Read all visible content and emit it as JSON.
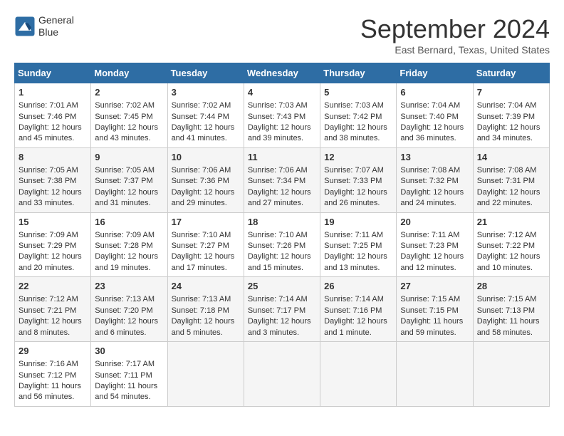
{
  "header": {
    "logo_line1": "General",
    "logo_line2": "Blue",
    "month": "September 2024",
    "location": "East Bernard, Texas, United States"
  },
  "weekdays": [
    "Sunday",
    "Monday",
    "Tuesday",
    "Wednesday",
    "Thursday",
    "Friday",
    "Saturday"
  ],
  "weeks": [
    [
      {
        "day": "1",
        "info": "Sunrise: 7:01 AM\nSunset: 7:46 PM\nDaylight: 12 hours\nand 45 minutes."
      },
      {
        "day": "2",
        "info": "Sunrise: 7:02 AM\nSunset: 7:45 PM\nDaylight: 12 hours\nand 43 minutes."
      },
      {
        "day": "3",
        "info": "Sunrise: 7:02 AM\nSunset: 7:44 PM\nDaylight: 12 hours\nand 41 minutes."
      },
      {
        "day": "4",
        "info": "Sunrise: 7:03 AM\nSunset: 7:43 PM\nDaylight: 12 hours\nand 39 minutes."
      },
      {
        "day": "5",
        "info": "Sunrise: 7:03 AM\nSunset: 7:42 PM\nDaylight: 12 hours\nand 38 minutes."
      },
      {
        "day": "6",
        "info": "Sunrise: 7:04 AM\nSunset: 7:40 PM\nDaylight: 12 hours\nand 36 minutes."
      },
      {
        "day": "7",
        "info": "Sunrise: 7:04 AM\nSunset: 7:39 PM\nDaylight: 12 hours\nand 34 minutes."
      }
    ],
    [
      {
        "day": "8",
        "info": "Sunrise: 7:05 AM\nSunset: 7:38 PM\nDaylight: 12 hours\nand 33 minutes."
      },
      {
        "day": "9",
        "info": "Sunrise: 7:05 AM\nSunset: 7:37 PM\nDaylight: 12 hours\nand 31 minutes."
      },
      {
        "day": "10",
        "info": "Sunrise: 7:06 AM\nSunset: 7:36 PM\nDaylight: 12 hours\nand 29 minutes."
      },
      {
        "day": "11",
        "info": "Sunrise: 7:06 AM\nSunset: 7:34 PM\nDaylight: 12 hours\nand 27 minutes."
      },
      {
        "day": "12",
        "info": "Sunrise: 7:07 AM\nSunset: 7:33 PM\nDaylight: 12 hours\nand 26 minutes."
      },
      {
        "day": "13",
        "info": "Sunrise: 7:08 AM\nSunset: 7:32 PM\nDaylight: 12 hours\nand 24 minutes."
      },
      {
        "day": "14",
        "info": "Sunrise: 7:08 AM\nSunset: 7:31 PM\nDaylight: 12 hours\nand 22 minutes."
      }
    ],
    [
      {
        "day": "15",
        "info": "Sunrise: 7:09 AM\nSunset: 7:29 PM\nDaylight: 12 hours\nand 20 minutes."
      },
      {
        "day": "16",
        "info": "Sunrise: 7:09 AM\nSunset: 7:28 PM\nDaylight: 12 hours\nand 19 minutes."
      },
      {
        "day": "17",
        "info": "Sunrise: 7:10 AM\nSunset: 7:27 PM\nDaylight: 12 hours\nand 17 minutes."
      },
      {
        "day": "18",
        "info": "Sunrise: 7:10 AM\nSunset: 7:26 PM\nDaylight: 12 hours\nand 15 minutes."
      },
      {
        "day": "19",
        "info": "Sunrise: 7:11 AM\nSunset: 7:25 PM\nDaylight: 12 hours\nand 13 minutes."
      },
      {
        "day": "20",
        "info": "Sunrise: 7:11 AM\nSunset: 7:23 PM\nDaylight: 12 hours\nand 12 minutes."
      },
      {
        "day": "21",
        "info": "Sunrise: 7:12 AM\nSunset: 7:22 PM\nDaylight: 12 hours\nand 10 minutes."
      }
    ],
    [
      {
        "day": "22",
        "info": "Sunrise: 7:12 AM\nSunset: 7:21 PM\nDaylight: 12 hours\nand 8 minutes."
      },
      {
        "day": "23",
        "info": "Sunrise: 7:13 AM\nSunset: 7:20 PM\nDaylight: 12 hours\nand 6 minutes."
      },
      {
        "day": "24",
        "info": "Sunrise: 7:13 AM\nSunset: 7:18 PM\nDaylight: 12 hours\nand 5 minutes."
      },
      {
        "day": "25",
        "info": "Sunrise: 7:14 AM\nSunset: 7:17 PM\nDaylight: 12 hours\nand 3 minutes."
      },
      {
        "day": "26",
        "info": "Sunrise: 7:14 AM\nSunset: 7:16 PM\nDaylight: 12 hours\nand 1 minute."
      },
      {
        "day": "27",
        "info": "Sunrise: 7:15 AM\nSunset: 7:15 PM\nDaylight: 11 hours\nand 59 minutes."
      },
      {
        "day": "28",
        "info": "Sunrise: 7:15 AM\nSunset: 7:13 PM\nDaylight: 11 hours\nand 58 minutes."
      }
    ],
    [
      {
        "day": "29",
        "info": "Sunrise: 7:16 AM\nSunset: 7:12 PM\nDaylight: 11 hours\nand 56 minutes."
      },
      {
        "day": "30",
        "info": "Sunrise: 7:17 AM\nSunset: 7:11 PM\nDaylight: 11 hours\nand 54 minutes."
      },
      {
        "day": "",
        "info": ""
      },
      {
        "day": "",
        "info": ""
      },
      {
        "day": "",
        "info": ""
      },
      {
        "day": "",
        "info": ""
      },
      {
        "day": "",
        "info": ""
      }
    ]
  ]
}
